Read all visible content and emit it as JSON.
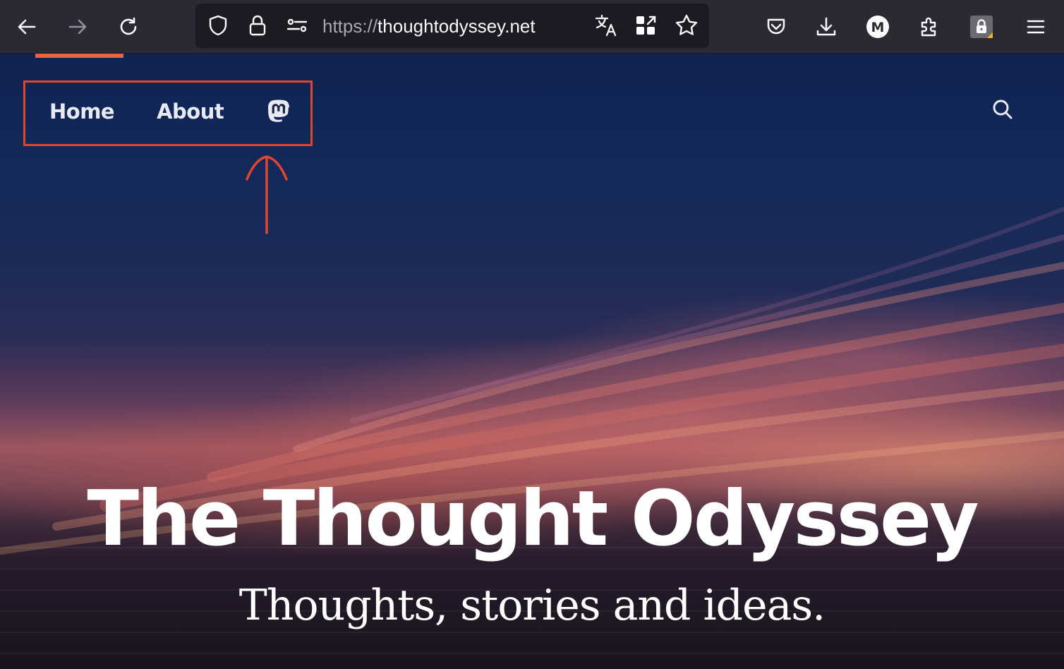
{
  "browser": {
    "url_scheme": "https://",
    "url_host": "thoughtodyssey.net",
    "account_initial": "M",
    "icons": {
      "back": "back-arrow-icon",
      "forward": "forward-arrow-icon",
      "reload": "reload-icon",
      "tracking": "shield-icon",
      "lock": "lock-icon",
      "permissions": "permissions-icon",
      "translate": "translate-icon",
      "extensions_grid": "grid-icon",
      "bookmark": "star-icon",
      "pocket": "pocket-icon",
      "downloads": "download-icon",
      "account": "account-icon",
      "extensions": "puzzle-icon",
      "password": "password-icon",
      "menu": "hamburger-menu-icon"
    }
  },
  "site": {
    "nav": {
      "items": [
        {
          "label": "Home"
        },
        {
          "label": "About"
        }
      ],
      "mastodon_icon": "mastodon-icon",
      "search_icon": "search-icon"
    },
    "title": "The Thought Odyssey",
    "tagline": "Thoughts, stories and ideas.",
    "accent_color": "#e8643c"
  },
  "annotation": {
    "color": "#e0462e"
  }
}
